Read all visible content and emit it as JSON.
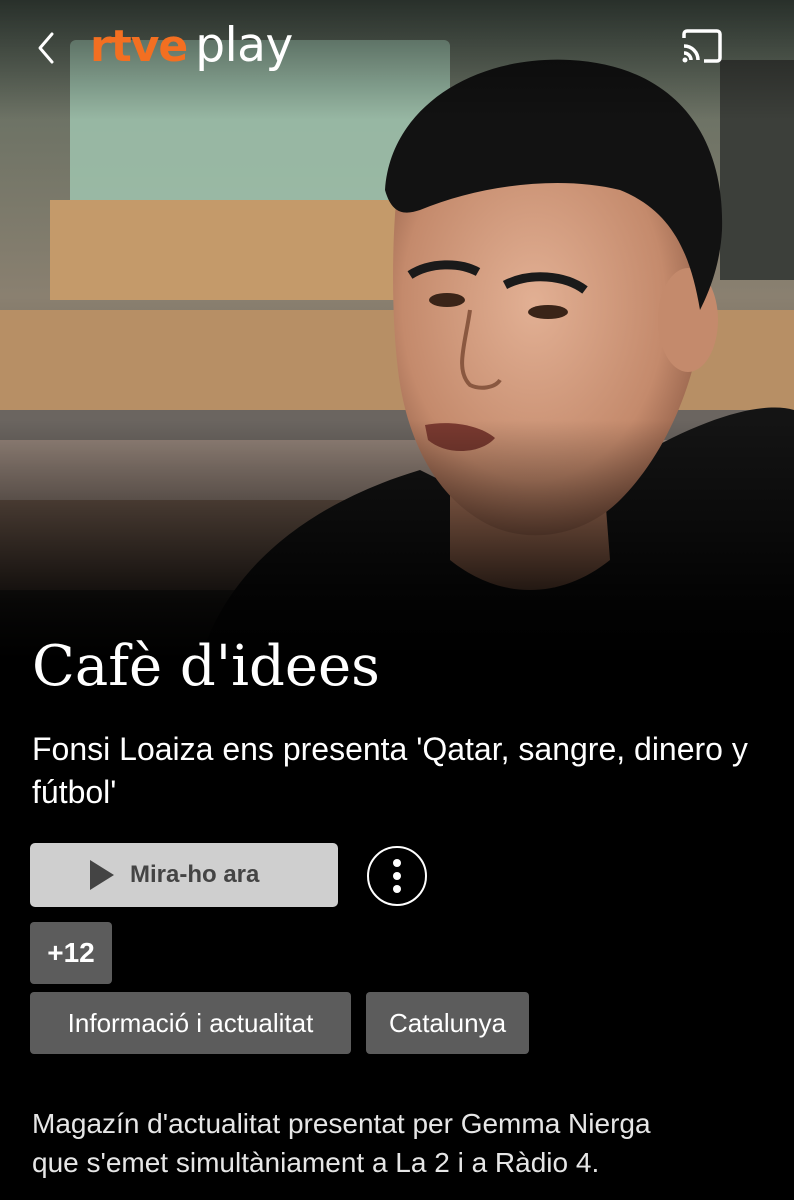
{
  "header": {
    "logo_brand": "rtve",
    "logo_product": "play",
    "back_icon": "chevron-left-icon",
    "cast_icon": "cast-icon"
  },
  "hero": {
    "image": "studio-interview-still"
  },
  "program": {
    "title": "Cafè d'idees",
    "episode_title": "Fonsi Loaiza ens presenta 'Qatar, sangre, dinero y fútbol'",
    "play_label": "Mira-ho ara",
    "play_icon": "play-icon",
    "more_icon": "more-vertical-icon",
    "age_rating": "+12",
    "tags": [
      "Informació i actualitat",
      "Catalunya"
    ],
    "description": "Magazín d'actualitat presentat per Gemma Nierga\nque  s'emet simultàniament a La 2 i a Ràdio 4."
  },
  "colors": {
    "brand_orange": "#f36f21",
    "background": "#000000",
    "play_button_bg": "#cfcfcf",
    "chip_bg": "#5c5c5c"
  }
}
